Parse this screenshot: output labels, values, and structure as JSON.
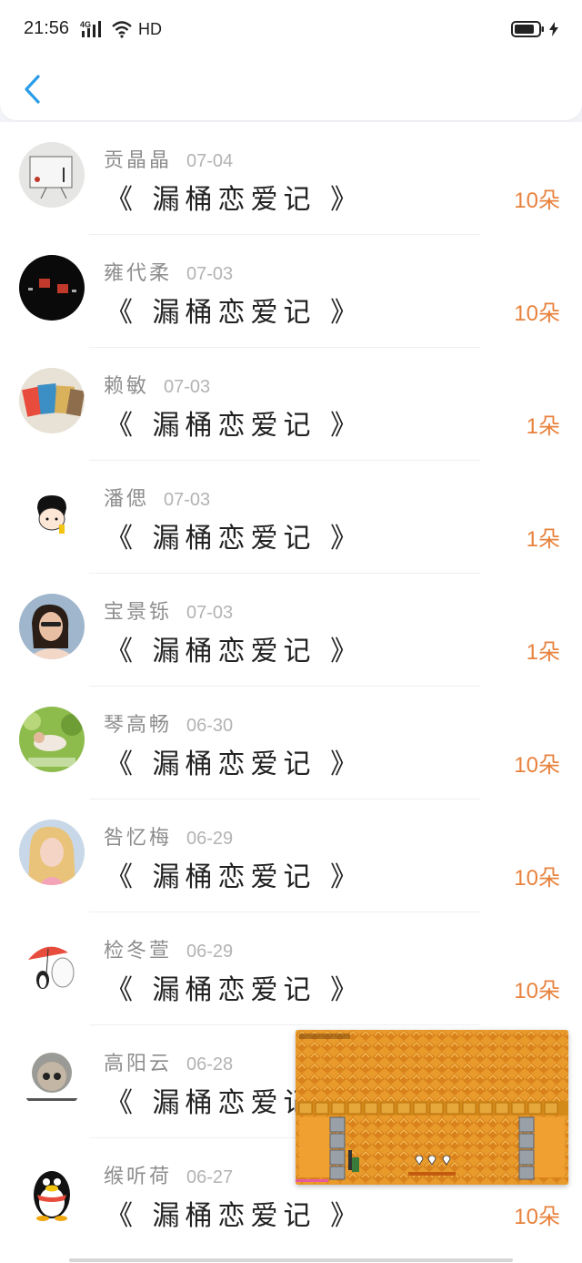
{
  "status": {
    "time": "21:56",
    "network": "4G",
    "hd": "HD"
  },
  "items": [
    {
      "name": "贡晶晶",
      "date": "07-04",
      "title": "《 漏桶恋爱记 》",
      "count": "10朵"
    },
    {
      "name": "雍代柔",
      "date": "07-03",
      "title": "《 漏桶恋爱记 》",
      "count": "10朵"
    },
    {
      "name": "赖敏",
      "date": "07-03",
      "title": "《 漏桶恋爱记 》",
      "count": "1朵"
    },
    {
      "name": "潘偲",
      "date": "07-03",
      "title": "《 漏桶恋爱记 》",
      "count": "1朵"
    },
    {
      "name": "宝景铄",
      "date": "07-03",
      "title": "《 漏桶恋爱记 》",
      "count": "1朵"
    },
    {
      "name": "琴高畅",
      "date": "06-30",
      "title": "《 漏桶恋爱记 》",
      "count": "10朵"
    },
    {
      "name": "咎忆梅",
      "date": "06-29",
      "title": "《 漏桶恋爱记 》",
      "count": "10朵"
    },
    {
      "name": "检冬萱",
      "date": "06-29",
      "title": "《 漏桶恋爱记 》",
      "count": "10朵"
    },
    {
      "name": "高阳云",
      "date": "06-28",
      "title": "《 漏桶恋爱记 》",
      "count": ""
    },
    {
      "name": "缑听荷",
      "date": "06-27",
      "title": "《 漏桶恋爱记 》",
      "count": "10朵"
    }
  ],
  "colors": {
    "accent": "#e8823d",
    "back": "#2a9ce8",
    "name": "#8d8d8d",
    "date": "#b3b3b3"
  }
}
